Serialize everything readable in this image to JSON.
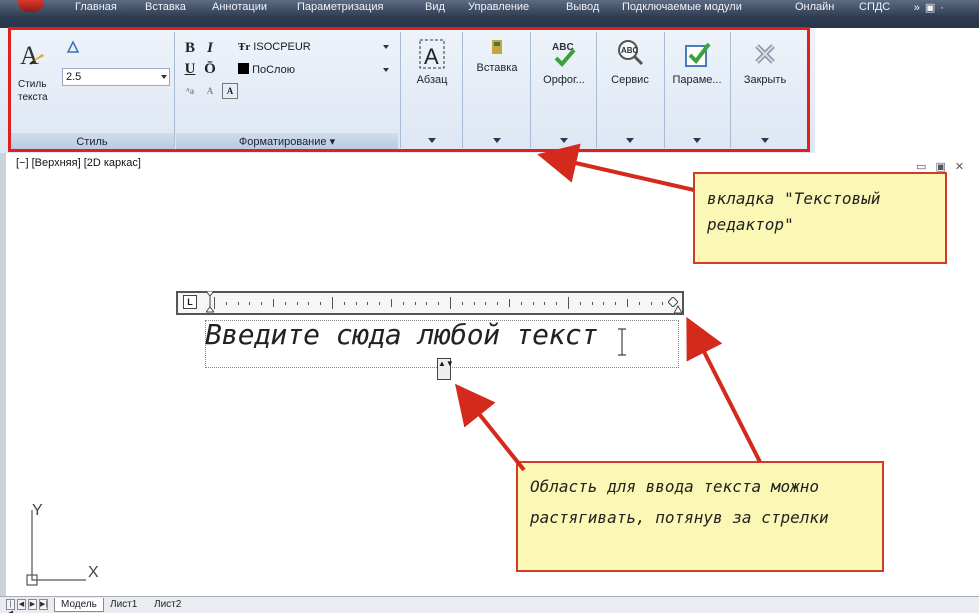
{
  "menu": {
    "items": [
      "Главная",
      "Вставка",
      "Аннотации",
      "Параметризация",
      "Вид",
      "Управление",
      "Вывод",
      "Подключаемые модули",
      "Онлайн",
      "СПДС"
    ],
    "extras": "»  ▣ ·"
  },
  "ribbon": {
    "style_panel": {
      "text_style_label": "Стиль текста",
      "height_value": "2.5",
      "title": "Стиль"
    },
    "format_panel": {
      "font_value": "ISOCPEUR",
      "font_prefix": "Ŧr",
      "color_value": "ПоСлою",
      "bold": "B",
      "italic": "I",
      "underline": "U",
      "overline": "Ō",
      "title": "Форматирование ▾"
    },
    "buttons": [
      {
        "label": "Абзац"
      },
      {
        "label": "Вставка"
      },
      {
        "label": "Орфог..."
      },
      {
        "label": "Сервис"
      },
      {
        "label": "Параме..."
      },
      {
        "label": "Закрыть"
      }
    ]
  },
  "viewport": {
    "label": "[−] [Верхняя] [2D каркас]",
    "window_controls": "▭ ▣ ✕",
    "ruler_tab_marker": "L",
    "typed_text": "Введите сюда любой текст",
    "resize_handle": "▲▼"
  },
  "callouts": {
    "tab": "вкладка \"Текстовый редактор\"",
    "area": "Область для ввода текста можно растягивать, потянув за стрелки"
  },
  "ucs": {
    "x": "X",
    "y": "Y"
  },
  "tabs": {
    "nav": [
      "|◀",
      "◀",
      "▶",
      "▶|"
    ],
    "items": [
      "Модель",
      "Лист1",
      "Лист2"
    ]
  },
  "colors": {
    "highlight": "#e0201c",
    "callout_bg": "#fbf7b4",
    "arrow": "#d42a1e"
  }
}
